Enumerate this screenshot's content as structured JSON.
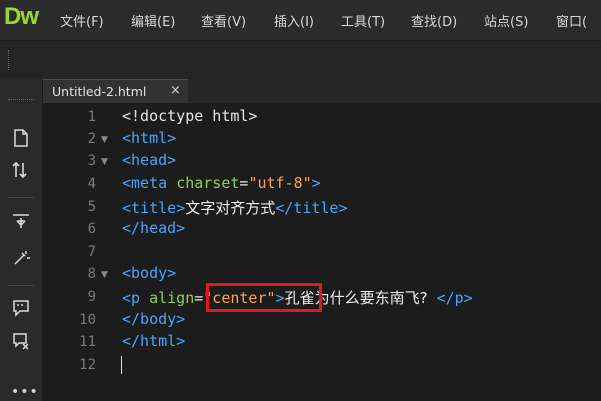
{
  "app": {
    "logo": "Dw"
  },
  "menu": [
    "文件(F)",
    "编辑(E)",
    "查看(V)",
    "插入(I)",
    "工具(T)",
    "查找(D)",
    "站点(S)",
    "窗口("
  ],
  "tab": {
    "title": "Untitled-2.html",
    "close": "×"
  },
  "editor": {
    "lines": [
      {
        "n": "1",
        "fold": ""
      },
      {
        "n": "2",
        "fold": "▼"
      },
      {
        "n": "3",
        "fold": "▼"
      },
      {
        "n": "4",
        "fold": ""
      },
      {
        "n": "5",
        "fold": ""
      },
      {
        "n": "6",
        "fold": ""
      },
      {
        "n": "7",
        "fold": ""
      },
      {
        "n": "8",
        "fold": "▼"
      },
      {
        "n": "9",
        "fold": ""
      },
      {
        "n": "10",
        "fold": ""
      },
      {
        "n": "11",
        "fold": ""
      },
      {
        "n": "12",
        "fold": ""
      }
    ],
    "code": {
      "l1": "<!doctype html>",
      "l2": "<html>",
      "l3": "<head>",
      "l4_tag_open": "<meta",
      "l4_attr": "charset",
      "l4_eq": "=",
      "l4_val": "\"utf-8\"",
      "l4_close": ">",
      "l5_open": "<title>",
      "l5_text": "文字对齐方式",
      "l5_close": "</title>",
      "l6": "</head>",
      "l8": "<body>",
      "l9_open": "<p",
      "l9_attr": "align",
      "l9_eq": "=",
      "l9_val": "\"center\"",
      "l9_gt": ">",
      "l9_text": "孔雀为什么要东南飞?",
      "l9_close": "</p>",
      "l10": "</body>",
      "l11": "</html>"
    }
  },
  "colors": {
    "tag": "#43a7ff",
    "attr": "#8bd34f",
    "string": "#ffa24a",
    "highlight": "#e0191c",
    "logo": "#9ad72a"
  },
  "sidebar_icons": [
    "new-file-icon",
    "sort-icon",
    "expand-icon",
    "wand-icon",
    "comment-icon",
    "comment-remove-icon",
    "more-icon"
  ]
}
